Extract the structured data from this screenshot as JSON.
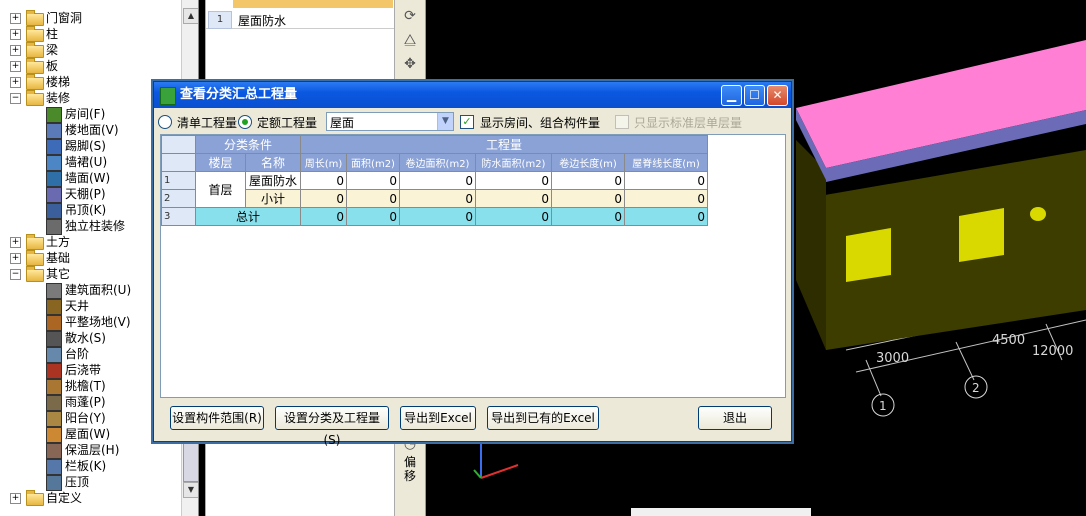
{
  "tree": {
    "items": [
      {
        "label": "门窗洞",
        "expanded": false
      },
      {
        "label": "柱",
        "expanded": false
      },
      {
        "label": "梁",
        "expanded": false
      },
      {
        "label": "板",
        "expanded": false
      },
      {
        "label": "楼梯",
        "expanded": false
      },
      {
        "label": "装修",
        "expanded": true,
        "children": [
          "房间(F)",
          "楼地面(V)",
          "踢脚(S)",
          "墙裙(U)",
          "墙面(W)",
          "天棚(P)",
          "吊顶(K)",
          "独立柱装修"
        ]
      },
      {
        "label": "土方",
        "expanded": false
      },
      {
        "label": "基础",
        "expanded": false
      },
      {
        "label": "其它",
        "expanded": true,
        "children": [
          "建筑面积(U)",
          "天井",
          "平整场地(V)",
          "散水(S)",
          "台阶",
          "后浇带",
          "挑檐(T)",
          "雨蓬(P)",
          "阳台(Y)",
          "屋面(W)",
          "保温层(H)",
          "栏板(K)",
          "压顶"
        ]
      },
      {
        "label": "自定义",
        "expanded": false
      }
    ]
  },
  "prop_list": {
    "row_number": "1",
    "row_value": "屋面防水"
  },
  "toolbar": {
    "offset_label": "偏移"
  },
  "view": {
    "dims": [
      "3000",
      "4500",
      "12000"
    ],
    "axes": [
      "1",
      "2"
    ]
  },
  "dialog": {
    "title": "查看分类汇总工程量",
    "options": {
      "radio_bill": "清单工程量",
      "radio_quota": "定额工程量",
      "select_value": "屋面",
      "check_show_rooms": "显示房间、组合构件量",
      "check_std_floor": "只显示标准层单层量"
    },
    "grid": {
      "group_headers": {
        "category": "分类条件",
        "quantity": "工程量"
      },
      "columns": [
        "楼层",
        "名称",
        "周长(m)",
        "面积(m2)",
        "卷边面积(m2)",
        "防水面积(m2)",
        "卷边长度(m)",
        "屋脊线长度(m)"
      ],
      "rows": [
        {
          "num": "1",
          "floor": "首层",
          "name": "屋面防水",
          "values": [
            "0",
            "0",
            "0",
            "0",
            "0",
            "0"
          ]
        },
        {
          "num": "2",
          "floor": "",
          "name": "小计",
          "values": [
            "0",
            "0",
            "0",
            "0",
            "0",
            "0"
          ]
        },
        {
          "num": "3",
          "floor": "",
          "name": "总计",
          "values": [
            "0",
            "0",
            "0",
            "0",
            "0",
            "0"
          ]
        }
      ]
    },
    "buttons": {
      "set_range": "设置构件范围(R)",
      "set_category": "设置分类及工程量(S)",
      "export_excel": "导出到Excel",
      "export_existing": "导出到已有的Excel",
      "exit": "退出"
    }
  },
  "colors": {
    "title_bar": "#0b58e0",
    "total_row": "#88e0ec",
    "header": "#8ba2d6",
    "roof": "#ff7fd4",
    "wall": "#3d3d00"
  }
}
